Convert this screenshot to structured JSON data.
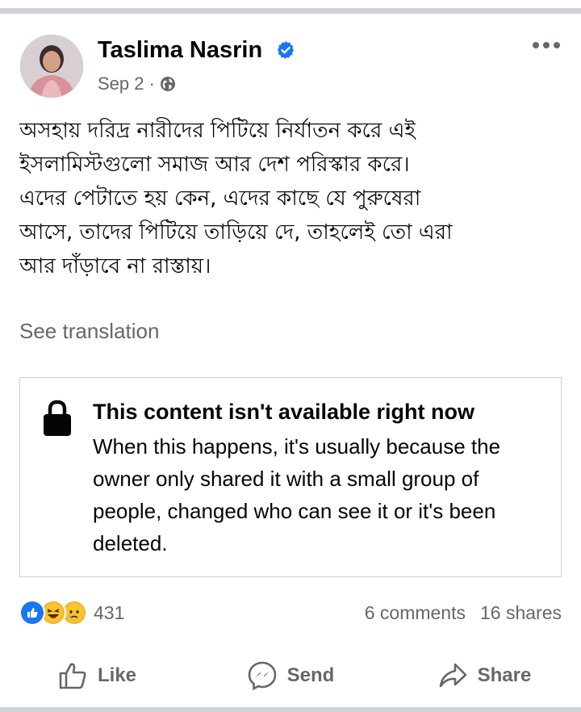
{
  "post": {
    "author": "Taslima Nasrin",
    "date": "Sep 2",
    "separator": "·",
    "text": "অসহায় দরিদ্র নারীদের পিটিয়ে নির্যাতন করে এই\nইসলামিস্টগুলো সমাজ আর দেশ পরিস্কার করে।\nএদের পেটাতে হয় কেন, এদের কাছে যে পুরুষেরা\nআসে, তাদের পিটিয়ে তাড়িয়ে দে, তাহলেই তো এরা\nআর দাঁড়াবে না রাস্তায়।",
    "see_translation": "See translation"
  },
  "unavailable": {
    "title": "This content isn't available right now",
    "description": "When this happens, it's usually because the owner only shared it with a small group of people, changed who can see it or it's been deleted."
  },
  "engagement": {
    "reaction_count": "431",
    "comments": "6 comments",
    "shares": "16 shares"
  },
  "actions": {
    "like": "Like",
    "send": "Send",
    "share": "Share"
  },
  "icons": {
    "verified": "verified-badge-icon",
    "audience": "globe-icon",
    "more": "more-options-icon",
    "lock": "lock-icon",
    "reactions": [
      "like-reaction-icon",
      "haha-reaction-icon",
      "sad-reaction-icon"
    ]
  },
  "colors": {
    "verified_blue": "#1877f2",
    "secondary_text": "#65676b",
    "border": "#ced0d4"
  }
}
